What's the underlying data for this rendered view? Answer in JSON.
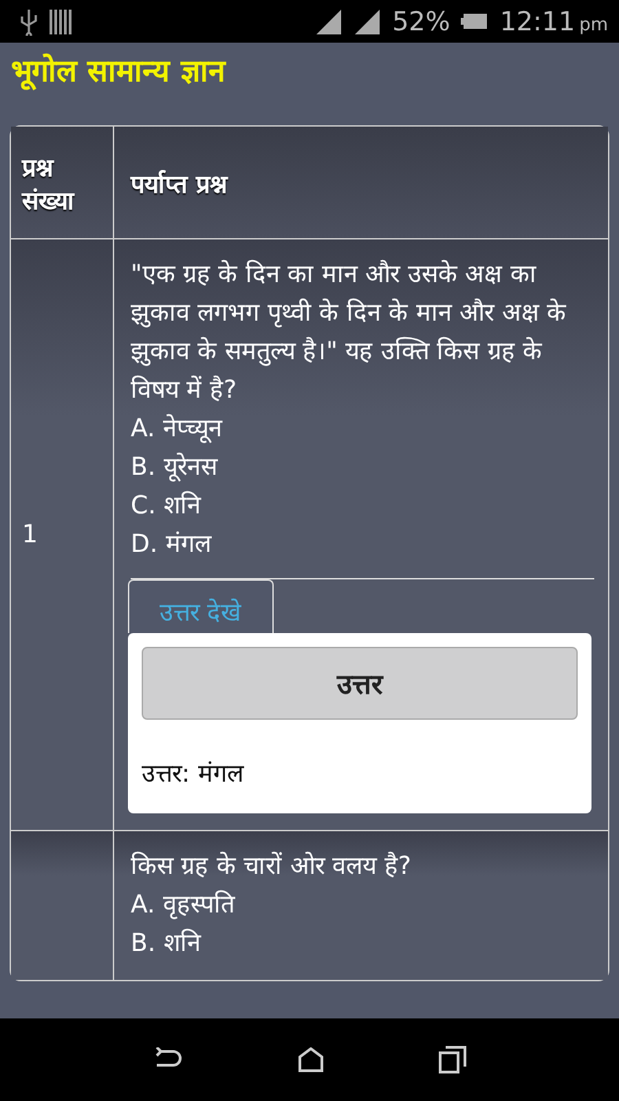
{
  "status_bar": {
    "battery": "52%",
    "time": "12:11",
    "time_suffix": "pm"
  },
  "title": "भूगोल सामान्य ज्ञान",
  "table": {
    "columns": [
      "प्रश्न संख्या",
      "पर्याप्त प्रश्न"
    ],
    "rows": [
      {
        "number": "1",
        "question": "\"एक ग्रह के दिन का मान और उसके अक्ष का झुकाव लगभग पृथ्वी के दिन के मान और अक्ष के झुकाव के समतुल्य है।\" यह उक्ति किस ग्रह के विषय में है?",
        "options": [
          "A. नेप्च्यून",
          "B. यूरेनस",
          "C. शनि",
          "D. मंगल"
        ],
        "answer": {
          "tab": "उत्तर देखे",
          "expanded": true,
          "heading": "उत्तर",
          "text": "उत्तर: मंगल"
        }
      },
      {
        "question": "किस ग्रह के चारों ओर वलय है?",
        "options": [
          "A. वृहस्पति",
          "B. शनि"
        ]
      }
    ]
  }
}
